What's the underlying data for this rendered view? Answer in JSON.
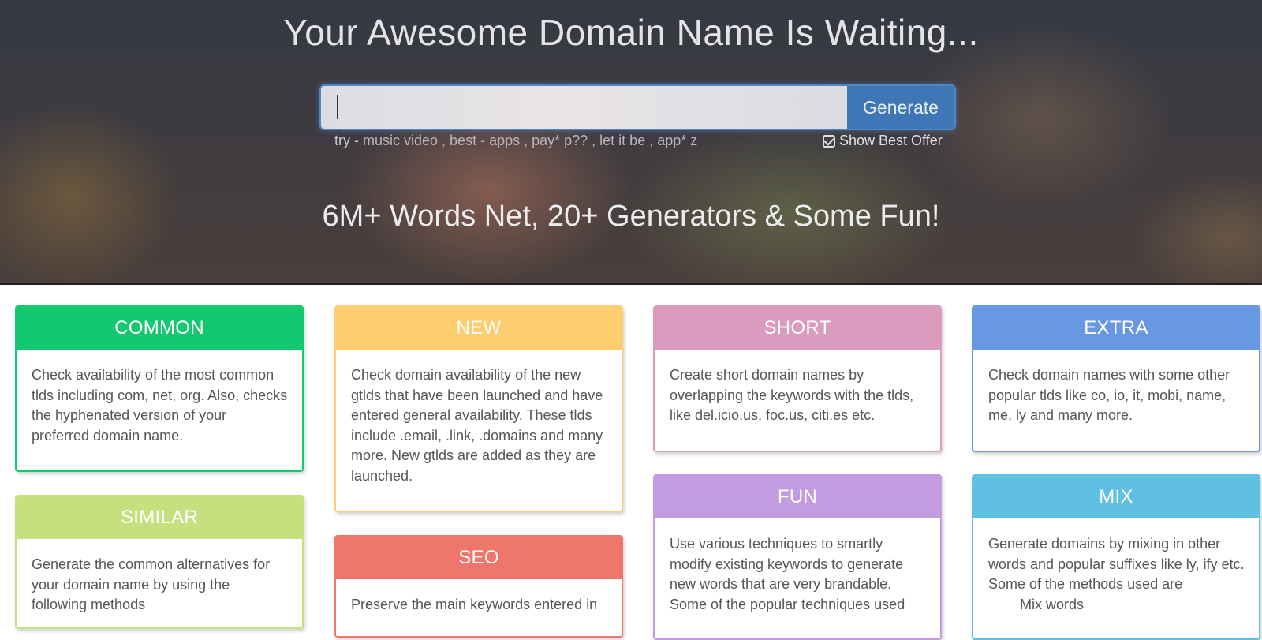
{
  "hero": {
    "title": "Your Awesome Domain Name Is Waiting...",
    "search": {
      "value": "",
      "placeholder": ""
    },
    "generate_label": "Generate",
    "try_prefix": "try -",
    "examples": [
      " music video ,",
      " best - apps ,",
      " pay* p?? ,",
      " let it be ,",
      " app* z"
    ],
    "best_offer_label": "Show Best Offer",
    "subtitle": "6M+ Words Net, 20+ Generators & Some Fun!"
  },
  "cards": {
    "common": {
      "title": "COMMON",
      "text": "Check availability of the most common tlds including com, net, org. Also, checks the hyphenated version of your preferred domain name.",
      "color": "#14c86f"
    },
    "new": {
      "title": "NEW",
      "text": "Check domain availability of the new gtlds that have been launched and have entered general availability. These tlds include .email, .link, .domains and many more. New gtlds are added as they are launched.",
      "color": "#fdcd70"
    },
    "short": {
      "title": "SHORT",
      "text": "Create short domain names by overlapping the keywords with the tlds, like del.icio.us, foc.us, citi.es etc.",
      "color": "#da9bbf"
    },
    "extra": {
      "title": "EXTRA",
      "text": "Check domain names with some other popular tlds like co, io, it, mobi, name, me, ly and many more.",
      "color": "#6898e1"
    },
    "similar": {
      "title": "SIMILAR",
      "text": "Generate the common alternatives for your domain name by using the following methods",
      "color": "#c5e07e"
    },
    "seo": {
      "title": "SEO",
      "text": "Preserve the main keywords entered in",
      "color": "#ee766b"
    },
    "fun": {
      "title": "FUN",
      "text": "Use various techniques to smartly modify existing keywords to generate new words that are very brandable. Some of the popular techniques used",
      "color": "#c39be0"
    },
    "mix": {
      "title": "MIX",
      "text": "Generate domains by mixing in other words and popular suffixes like ly, ify etc. Some of the methods used are",
      "list_item": "Mix words",
      "color": "#5fc0e2"
    }
  }
}
